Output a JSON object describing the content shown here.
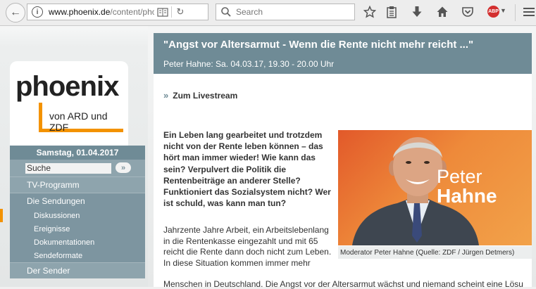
{
  "browser": {
    "url_domain": "www.phoenix.de",
    "url_path": "/content/phoe",
    "search_placeholder": "Search",
    "abp_label": "ABP"
  },
  "sidebar": {
    "logo_text": "phoenix",
    "logo_sub": "von ARD und ZDF",
    "date": "Samstag, 01.04.2017",
    "search_value": "Suche",
    "search_button": "»",
    "items": [
      {
        "label": "TV-Programm"
      },
      {
        "label": "Die Sendungen"
      },
      {
        "label": "Diskussionen"
      },
      {
        "label": "Ereignisse"
      },
      {
        "label": "Dokumentationen"
      },
      {
        "label": "Sendeformate"
      },
      {
        "label": "Der Sender"
      }
    ]
  },
  "article": {
    "title": "\"Angst vor Altersarmut - Wenn die Rente nicht mehr reicht ...\"",
    "subtitle": "Peter Hahne: Sa. 04.03.17, 19.30 - 20.00 Uhr",
    "livestream_arrow": "»",
    "livestream_label": "Zum Livestream",
    "lead": "Ein Leben lang gearbeitet und trotzdem nicht von der Rente leben können – das hört man immer wieder! Wie kann das sein? Verpulvert die Politik die Rentenbeiträge an anderer Stelle? Funktioniert das Sozialsystem nicht? Wer ist schuld, was kann man tun?",
    "body": "Jahrzente Jahre Arbeit, ein Arbeitslebenlang in die Rentenkasse eingezahlt und mit 65 reicht die Rente dann doch nicht zum Leben. In diese Situation kommen immer mehr",
    "body_last": "Menschen in Deutschland. Die Angst vor der Altersarmut wächst und niemand scheint eine Lösu",
    "photo_caption": "Moderator Peter Hahne (Quelle: ZDF / Jürgen Detmers)",
    "photo_logo_line1": "Peter",
    "photo_logo_line2": "Hahne"
  },
  "colors": {
    "accent": "#f39200",
    "nav_bg": "#8ea4ad",
    "header_bg": "#6f8b96"
  }
}
